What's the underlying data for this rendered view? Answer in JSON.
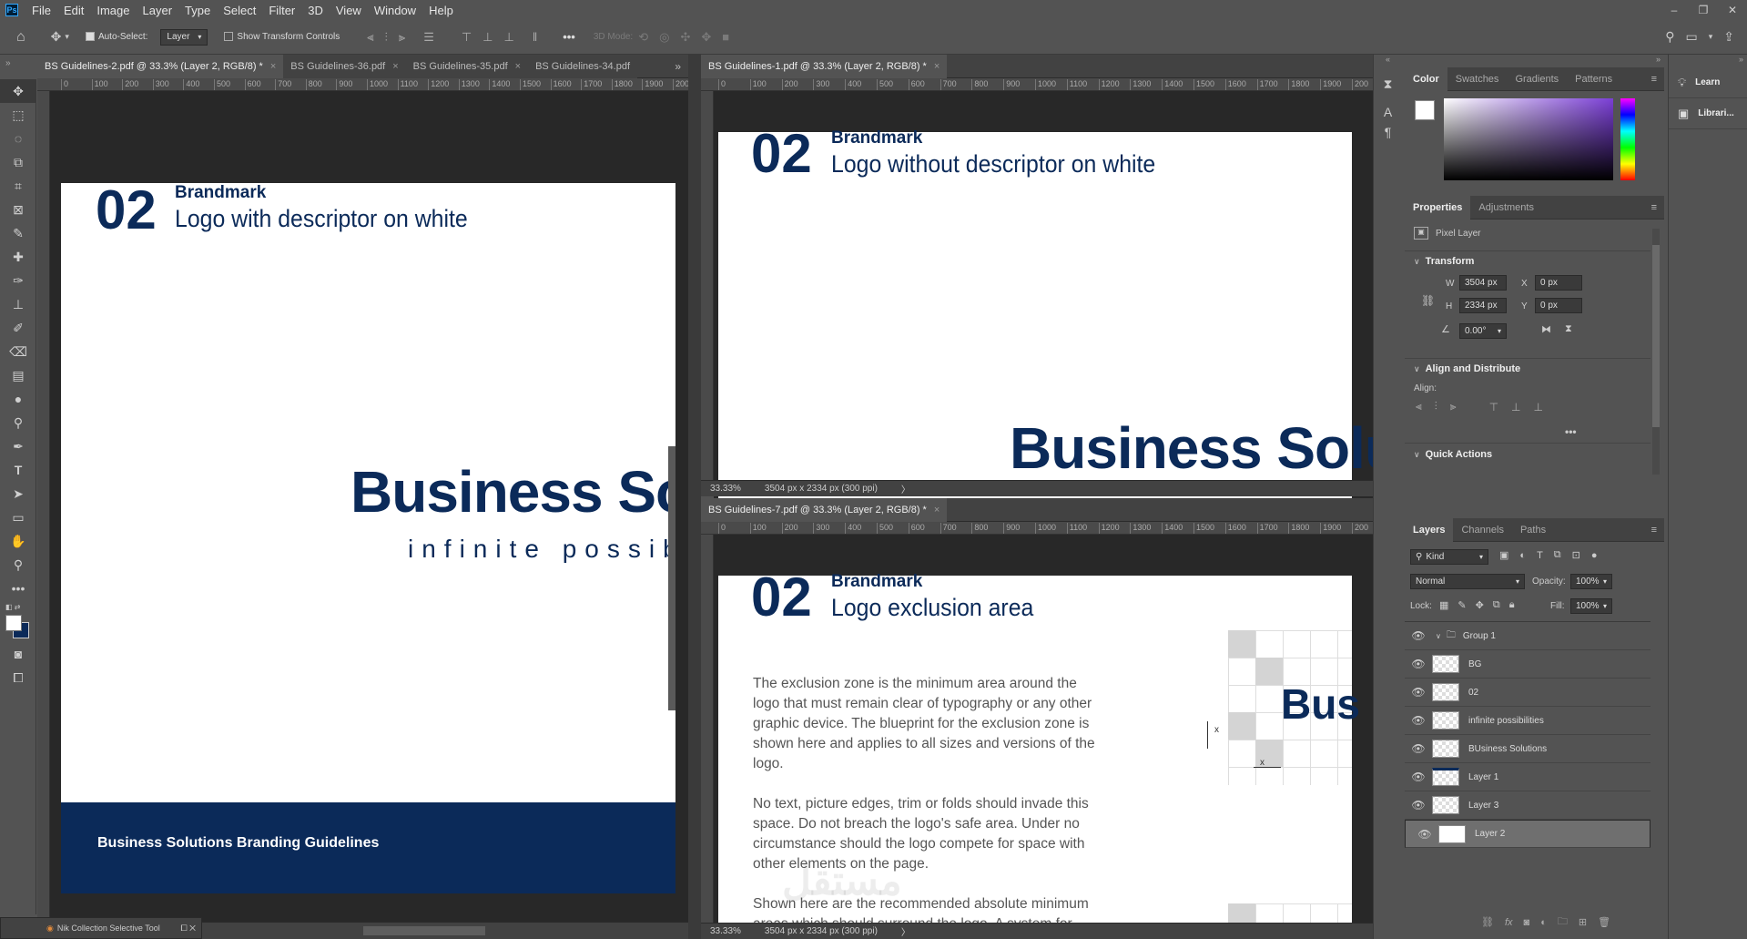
{
  "app": {
    "logo": "Ps"
  },
  "menu": [
    "File",
    "Edit",
    "Image",
    "Layer",
    "Type",
    "Select",
    "Filter",
    "3D",
    "View",
    "Window",
    "Help"
  ],
  "options": {
    "auto_select_label": "Auto-Select:",
    "auto_select_value": "Layer",
    "transform_label": "Show Transform Controls",
    "mode_3d": "3D Mode:"
  },
  "doc_left": {
    "tabs": [
      {
        "label": "BS Guidelines-2.pdf @ 33.3% (Layer 2, RGB/8) *",
        "close": "×"
      },
      {
        "label": "BS Guidelines-36.pdf",
        "close": "×"
      },
      {
        "label": "BS Guidelines-35.pdf",
        "close": "×"
      },
      {
        "label": "BS Guidelines-34.pdf",
        "close": ""
      }
    ],
    "overflow": "»",
    "ruler": [
      "0",
      "100",
      "200",
      "300",
      "400",
      "500",
      "600",
      "700",
      "800",
      "900",
      "1000",
      "1100",
      "1200",
      "1300",
      "1400",
      "1500",
      "1600",
      "1700",
      "1800",
      "1900",
      "200"
    ],
    "num": "02",
    "kicker": "Brandmark",
    "heading": "Logo with descriptor on white",
    "logo_text": "Business Solu",
    "tagline": "infinite possibi",
    "footer": "Business Solutions Branding Guidelines"
  },
  "doc_tr": {
    "tab": "BS Guidelines-1.pdf @ 33.3% (Layer 2, RGB/8) *",
    "close": "×",
    "ruler": [
      "0",
      "100",
      "200",
      "300",
      "400",
      "500",
      "600",
      "700",
      "800",
      "900",
      "1000",
      "1100",
      "1200",
      "1300",
      "1400",
      "1500",
      "1600",
      "1700",
      "1800",
      "1900",
      "200"
    ],
    "num": "02",
    "kicker": "Brandmark",
    "heading": "Logo without descriptor on white",
    "logo_text": "Business Solu",
    "zoom": "33.33%",
    "info": "3504 px x 2334 px (300 ppi)"
  },
  "doc_br": {
    "tab": "BS Guidelines-7.pdf @ 33.3% (Layer 2, RGB/8) *",
    "close": "×",
    "num": "02",
    "kicker": "Brandmark",
    "heading": "Logo exclusion area",
    "para1": "The exclusion zone is the minimum area around the logo that must remain clear of typography or any other graphic device. The blueprint for the exclusion zone is shown here and applies to all sizes and versions of the logo.",
    "para2": "No text, picture edges, trim or folds should invade this space. Do not breach the logo's safe area. Under no circumstance should the logo compete for space with other elements on the page.",
    "para3": "Shown here are the recommended absolute minimum areas which should surround the logo. A system for precise measurement is provided by using the width of",
    "logo_text": "Bus",
    "x1": "x",
    "x2": "x",
    "watermark": "مستقل",
    "zoom": "33.33%",
    "info": "3504 px x 2334 px (300 ppi)"
  },
  "bottom_left": {
    "plugin": "Nik Collection Selective Tool"
  },
  "color_panel": {
    "tabs": [
      "Color",
      "Swatches",
      "Gradients",
      "Patterns"
    ]
  },
  "props_panel": {
    "tabs": [
      "Properties",
      "Adjustments"
    ],
    "type": "Pixel Layer",
    "transform": "Transform",
    "w_label": "W",
    "w": "3504 px",
    "h_label": "H",
    "h": "2334 px",
    "x_label": "X",
    "x": "0 px",
    "y_label": "Y",
    "y": "0 px",
    "angle": "0.00°",
    "align_title": "Align and Distribute",
    "align_label": "Align:",
    "quick": "Quick Actions"
  },
  "layers_panel": {
    "tabs": [
      "Layers",
      "Channels",
      "Paths"
    ],
    "kind": "Kind",
    "blend": "Normal",
    "opacity_label": "Opacity:",
    "opacity": "100%",
    "lock_label": "Lock:",
    "fill_label": "Fill:",
    "fill": "100%",
    "layers": [
      "Group 1",
      "BG",
      "02",
      "infinite possibilities",
      "BUsiness Solutions",
      "Layer 1",
      "Layer 3",
      "Layer 2"
    ]
  },
  "side": {
    "learn": "Learn",
    "libraries": "Librari..."
  }
}
